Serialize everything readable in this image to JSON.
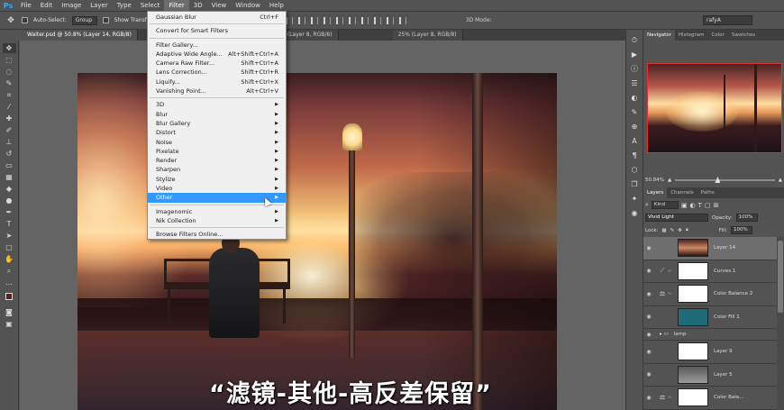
{
  "menubar": {
    "logo": "Ps",
    "items": [
      "File",
      "Edit",
      "Image",
      "Layer",
      "Type",
      "Select",
      "Filter",
      "3D",
      "View",
      "Window",
      "Help"
    ],
    "active_index": 6
  },
  "optionsbar": {
    "auto_select_label": "Auto-Select:",
    "auto_select_value": "Group",
    "show_transform_label": "Show Transf",
    "mode3d_label": "3D Mode:",
    "workspace": "rafyA"
  },
  "doc_tabs": [
    {
      "label": "Waiter.psd @ 50.8% (Layer 14, RGB/8)"
    },
    {
      "label": "(Layer 8, RGB/8)"
    },
    {
      "label": "25% (Layer 8, RGB/8)"
    }
  ],
  "filter_menu": {
    "items": [
      {
        "label": "Gaussian Blur",
        "shortcut": "Ctrl+F"
      },
      {
        "sep": true
      },
      {
        "label": "Convert for Smart Filters",
        "shortcut": ""
      },
      {
        "sep": true
      },
      {
        "label": "Filter Gallery...",
        "shortcut": ""
      },
      {
        "label": "Adaptive Wide Angle...",
        "shortcut": "Alt+Shift+Ctrl+A"
      },
      {
        "label": "Camera Raw Filter...",
        "shortcut": "Shift+Ctrl+A"
      },
      {
        "label": "Lens Correction...",
        "shortcut": "Shift+Ctrl+R"
      },
      {
        "label": "Liquify...",
        "shortcut": "Shift+Ctrl+X"
      },
      {
        "label": "Vanishing Point...",
        "shortcut": "Alt+Ctrl+V"
      },
      {
        "sep": true
      },
      {
        "label": "3D",
        "submenu": true
      },
      {
        "label": "Blur",
        "submenu": true
      },
      {
        "label": "Blur Gallery",
        "submenu": true
      },
      {
        "label": "Distort",
        "submenu": true
      },
      {
        "label": "Noise",
        "submenu": true
      },
      {
        "label": "Pixelate",
        "submenu": true
      },
      {
        "label": "Render",
        "submenu": true
      },
      {
        "label": "Sharpen",
        "submenu": true
      },
      {
        "label": "Stylize",
        "submenu": true
      },
      {
        "label": "Video",
        "submenu": true
      },
      {
        "label": "Other",
        "submenu": true,
        "highlighted": true
      },
      {
        "sep": true
      },
      {
        "label": "Imagenomic",
        "submenu": true
      },
      {
        "label": "Nik Collection",
        "submenu": true
      },
      {
        "sep": true
      },
      {
        "label": "Browse Filters Online...",
        "shortcut": ""
      }
    ]
  },
  "subtitle": "“滤镜-其他-高反差保留”",
  "navigator": {
    "tabs": [
      "Navigator",
      "Histogram",
      "Color",
      "Swatches"
    ],
    "zoom": "50.84%"
  },
  "layers_panel": {
    "tabs": [
      "Layers",
      "Channels",
      "Paths"
    ],
    "kind_label": "Kind",
    "blend_mode": "Vivid Light",
    "opacity_label": "Opacity:",
    "opacity_value": "100%",
    "lock_label": "Lock:",
    "fill_label": "Fill:",
    "fill_value": "100%",
    "layers": [
      {
        "name": "Layer 14",
        "thumb": "img",
        "active": true
      },
      {
        "name": "Curves 1",
        "thumb": "white",
        "adj": "curves-icon"
      },
      {
        "name": "Color Balance 2",
        "thumb": "white",
        "adj": "balance-icon"
      },
      {
        "name": "Color Fill 1",
        "thumb": "teal",
        "adj": ""
      },
      {
        "name": "lamp",
        "group": true
      },
      {
        "name": "Layer 9",
        "thumb": "white",
        "adj": ""
      },
      {
        "name": "Layer 5",
        "thumb": "gray",
        "adj": ""
      },
      {
        "name": "Color Bala...",
        "thumb": "white",
        "adj": "balance-icon"
      }
    ]
  },
  "colors": {
    "accent": "#3399ff",
    "ps_blue": "#31a8ff"
  }
}
